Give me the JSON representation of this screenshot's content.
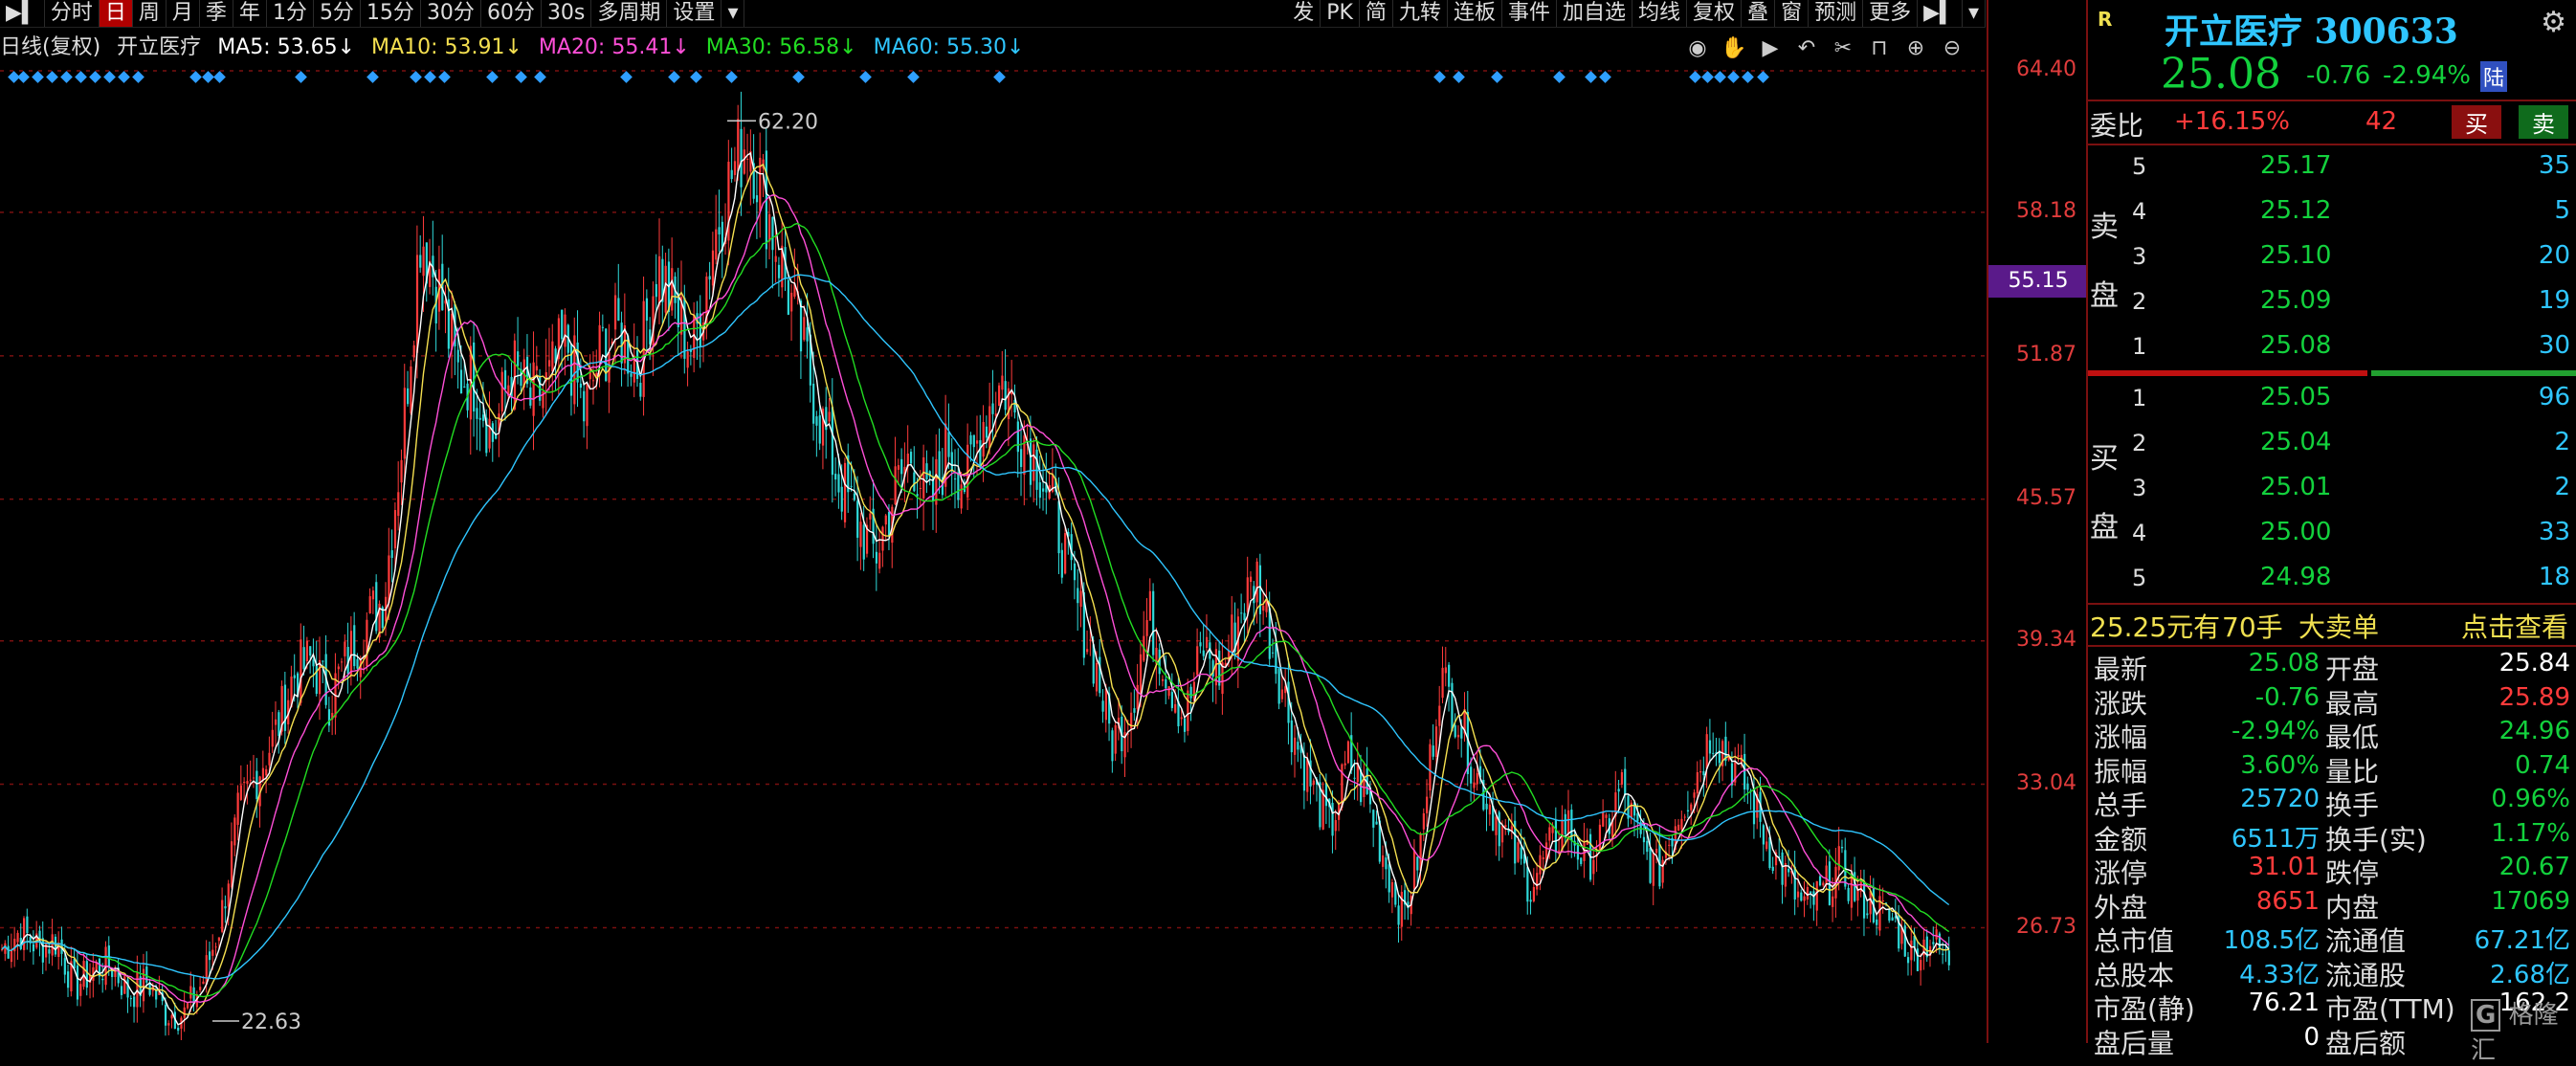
{
  "toolbar": {
    "left_items": [
      {
        "label": "分时",
        "active": false
      },
      {
        "label": "日",
        "active": true
      },
      {
        "label": "周",
        "active": false
      },
      {
        "label": "月",
        "active": false
      },
      {
        "label": "季",
        "active": false
      },
      {
        "label": "年",
        "active": false
      },
      {
        "label": "1分",
        "active": false
      },
      {
        "label": "5分",
        "active": false
      },
      {
        "label": "15分",
        "active": false
      },
      {
        "label": "30分",
        "active": false
      },
      {
        "label": "60分",
        "active": false
      },
      {
        "label": "30s",
        "active": false
      },
      {
        "label": "多周期",
        "active": false
      },
      {
        "label": "设置",
        "active": false
      }
    ],
    "right_items": [
      "发",
      "PK",
      "简",
      "九转",
      "连板",
      "事件",
      "加自选",
      "均线",
      "复权",
      "叠",
      "窗",
      "预测",
      "更多"
    ]
  },
  "legend": {
    "title": "日线(复权)",
    "stock": "开立医疗",
    "ma5": "MA5: 53.65↓",
    "ma10": "MA10: 53.91↓",
    "ma20": "MA20: 55.41↓",
    "ma30": "MA30: 56.58↓",
    "ma60": "MA60: 55.30↓"
  },
  "colors": {
    "up": "#ff3b3b",
    "down": "#2fd9d9",
    "ma5": "#ffffff",
    "ma10": "#f5e050",
    "ma20": "#ff4fd8",
    "ma30": "#22dd22",
    "ma60": "#2fc6ff",
    "grid": "#7a1010"
  },
  "chart": {
    "ymax_label": "64.40",
    "ticks": [
      "64.40",
      "58.18",
      "51.87",
      "45.57",
      "39.34",
      "33.04",
      "26.73"
    ],
    "current_price_tag": "55.15",
    "high_annotation": "62.20",
    "low_annotation": "22.63"
  },
  "chart_data": {
    "type": "candlestick",
    "ylim": [
      22.0,
      64.4
    ],
    "high": 62.2,
    "low": 22.63,
    "close_path": [
      25.8,
      26.6,
      25.9,
      26.2,
      24.1,
      24.9,
      25.1,
      23.8,
      24.4,
      23.0,
      22.9,
      24.3,
      27.0,
      31.8,
      33.5,
      35.2,
      37.8,
      38.5,
      36.8,
      38.6,
      40.1,
      41.3,
      48.3,
      57.5,
      54.8,
      51.1,
      50.9,
      48.2,
      51.4,
      49.8,
      50.5,
      52.6,
      49.3,
      52.3,
      52.9,
      51.4,
      55.9,
      53.8,
      52.1,
      56.7,
      59.6,
      61.8,
      58.5,
      55.4,
      52.2,
      49.1,
      46.4,
      44.6,
      43.1,
      45.8,
      47.6,
      45.2,
      48.0,
      46.2,
      49.3,
      50.8,
      48.7,
      47.1,
      44.5,
      41.1,
      38.6,
      34.9,
      36.4,
      40.5,
      38.1,
      35.8,
      39.1,
      37.9,
      40.6,
      42.2,
      38.5,
      35.2,
      32.9,
      31.0,
      34.1,
      32.5,
      29.7,
      27.2,
      30.5,
      37.8,
      36.1,
      33.5,
      31.8,
      30.2,
      28.6,
      30.1,
      31.4,
      29.5,
      30.8,
      32.9,
      30.4,
      29.1,
      31.6,
      33.2,
      35.5,
      34.1,
      32.7,
      30.5,
      29.0,
      27.6,
      28.2,
      29.4,
      28.1,
      27.6,
      26.9,
      25.5,
      26.3,
      25.1
    ]
  },
  "quote": {
    "badge": "R",
    "name": "开立医疗 300633",
    "price": "25.08",
    "change": "-0.76",
    "change_pct": "-2.94%",
    "tag": "陆",
    "weibi_label": "委比",
    "weibi_value": "+16.15%",
    "weicha": "42",
    "buy_btn": "买",
    "sell_btn": "卖",
    "sell_label_chars": [
      "卖",
      "盘"
    ],
    "buy_label_chars": [
      "买",
      "盘"
    ],
    "asks": [
      {
        "lvl": "5",
        "price": "25.17",
        "vol": "35"
      },
      {
        "lvl": "4",
        "price": "25.12",
        "vol": "5"
      },
      {
        "lvl": "3",
        "price": "25.10",
        "vol": "20"
      },
      {
        "lvl": "2",
        "price": "25.09",
        "vol": "19"
      },
      {
        "lvl": "1",
        "price": "25.08",
        "vol": "30"
      }
    ],
    "bids": [
      {
        "lvl": "1",
        "price": "25.05",
        "vol": "96"
      },
      {
        "lvl": "2",
        "price": "25.04",
        "vol": "2"
      },
      {
        "lvl": "3",
        "price": "25.01",
        "vol": "2"
      },
      {
        "lvl": "4",
        "price": "25.00",
        "vol": "33"
      },
      {
        "lvl": "5",
        "price": "24.98",
        "vol": "18"
      }
    ],
    "bigorder": {
      "price": "25.25元有",
      "vol": "70手",
      "text": "大卖单",
      "link": "点击查看"
    },
    "stats": [
      {
        "k1": "最新",
        "v1": "25.08",
        "c1": "green",
        "k2": "开盘",
        "v2": "25.84",
        "c2": "white"
      },
      {
        "k1": "涨跌",
        "v1": "-0.76",
        "c1": "green",
        "k2": "最高",
        "v2": "25.89",
        "c2": "red"
      },
      {
        "k1": "涨幅",
        "v1": "-2.94%",
        "c1": "green",
        "k2": "最低",
        "v2": "24.96",
        "c2": "green"
      },
      {
        "k1": "振幅",
        "v1": "3.60%",
        "c1": "green",
        "k2": "量比",
        "v2": "0.74",
        "c2": "green"
      },
      {
        "k1": "总手",
        "v1": "25720",
        "c1": "cyan",
        "k2": "换手",
        "v2": "0.96%",
        "c2": "green"
      },
      {
        "k1": "金额",
        "v1": "6511万",
        "c1": "cyan",
        "k2": "换手(实)",
        "v2": "1.17%",
        "c2": "green"
      },
      {
        "k1": "涨停",
        "v1": "31.01",
        "c1": "red",
        "k2": "跌停",
        "v2": "20.67",
        "c2": "green"
      },
      {
        "k1": "外盘",
        "v1": "8651",
        "c1": "red",
        "k2": "内盘",
        "v2": "17069",
        "c2": "green"
      },
      {
        "k1": "总市值",
        "v1": "108.5亿",
        "c1": "cyan",
        "k2": "流通值",
        "v2": "67.21亿",
        "c2": "cyan"
      },
      {
        "k1": "总股本",
        "v1": "4.33亿",
        "c1": "cyan",
        "k2": "流通股",
        "v2": "2.68亿",
        "c2": "cyan"
      },
      {
        "k1": "市盈(静)",
        "v1": "76.21",
        "c1": "white",
        "k2": "市盈(TTM)",
        "v2": "162.2",
        "c2": "white"
      },
      {
        "k1": "盘后量",
        "v1": "0",
        "c1": "white",
        "k2": "盘后额",
        "v2": "",
        "c2": "white"
      }
    ],
    "watermark": "格隆汇"
  }
}
